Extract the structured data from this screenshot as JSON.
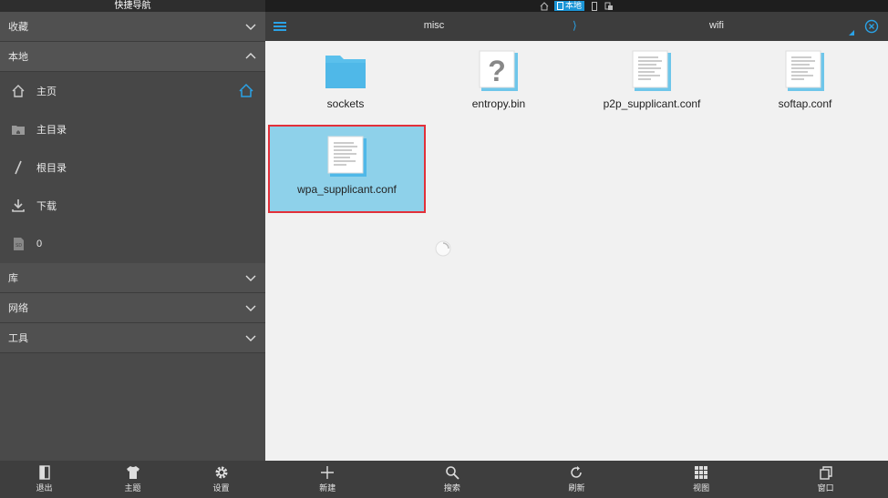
{
  "sidebar": {
    "title": "快捷导航",
    "sections": {
      "favorites": "收藏",
      "local": "本地",
      "library": "库",
      "network": "网络",
      "tools": "工具"
    },
    "local_items": [
      {
        "label": "主页"
      },
      {
        "label": "主目录"
      },
      {
        "label": "根目录"
      },
      {
        "label": "下载"
      },
      {
        "label": "0"
      }
    ],
    "bottom": {
      "exit": "退出",
      "theme": "主题",
      "settings": "设置"
    }
  },
  "statusbar": {
    "local_label": "本地"
  },
  "pathbar": {
    "crumb1": "misc",
    "separator": "⟩",
    "crumb2": "wifi"
  },
  "files": [
    {
      "name": "sockets",
      "type": "folder"
    },
    {
      "name": "entropy.bin",
      "type": "unknown"
    },
    {
      "name": "p2p_supplicant.conf",
      "type": "text"
    },
    {
      "name": "softap.conf",
      "type": "text"
    },
    {
      "name": "wpa_supplicant.conf",
      "type": "text",
      "selected": true
    }
  ],
  "toolbar": {
    "new": "新建",
    "search": "搜索",
    "refresh": "刷新",
    "view": "视图",
    "window": "窗口"
  },
  "colors": {
    "accent": "#1b95d6",
    "selection": "#8ed1ea",
    "highlight_border": "#e2303a"
  }
}
